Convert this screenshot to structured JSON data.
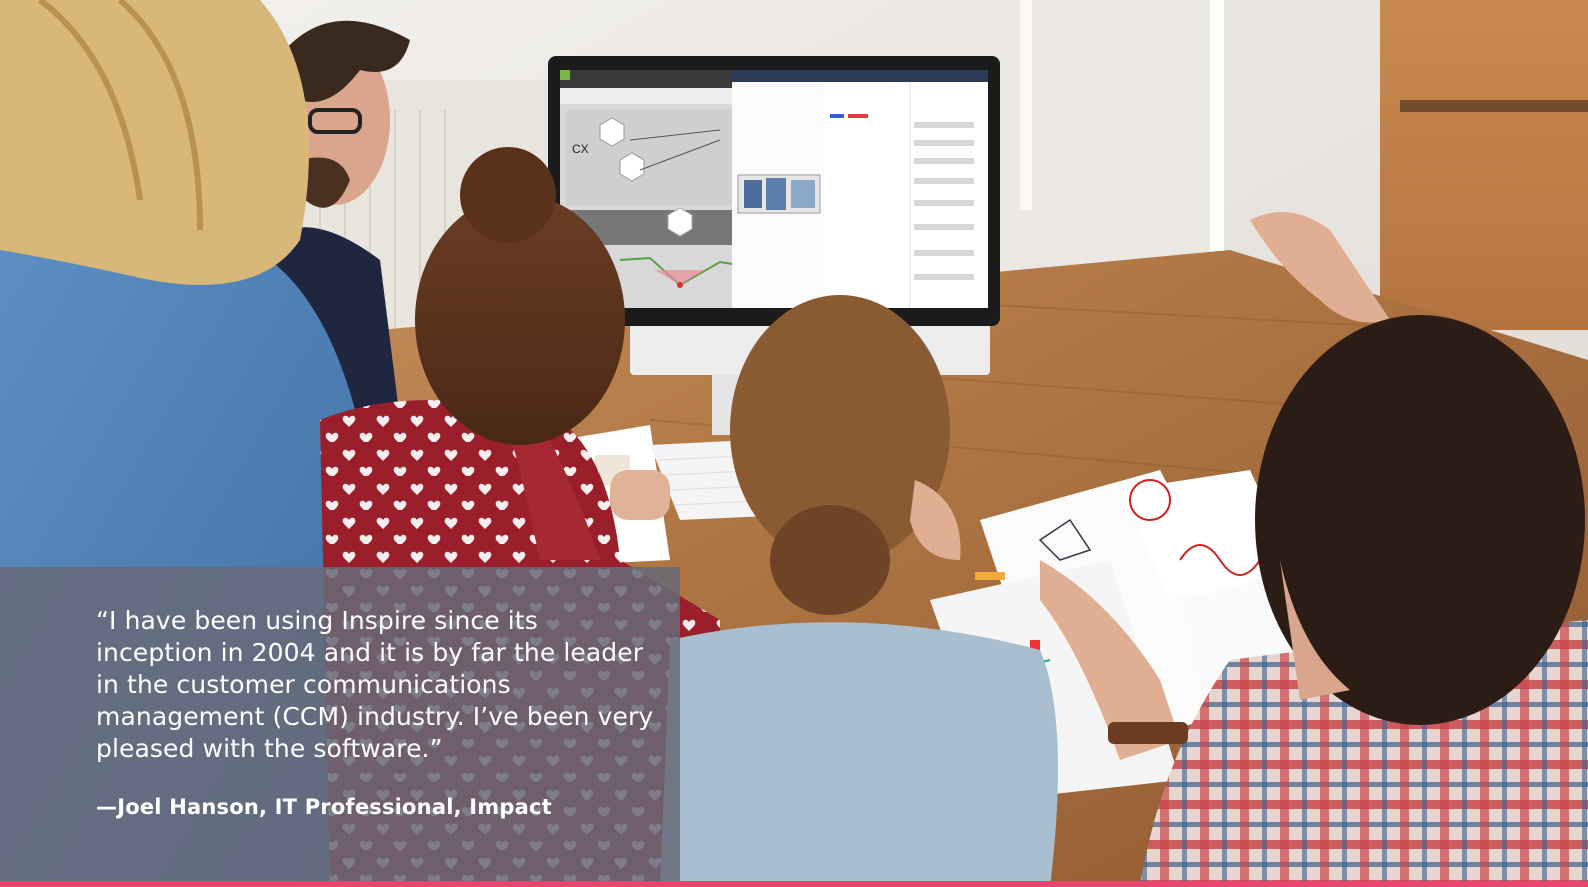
{
  "testimonial": {
    "quote": "“I have been using Inspire since its inception in 2004 and it is by far the leader in the customer communications management (CCM) industry. I’ve been very pleased with the software.”",
    "attribution": "—Joel Hanson, IT Professional, Impact"
  },
  "screen": {
    "canvas_label": "CX"
  },
  "colors": {
    "accent_bar": "#e8456f",
    "quote_panel": "#686a78",
    "quote_text": "#ffffff",
    "table_wood": "#b07a4b"
  }
}
